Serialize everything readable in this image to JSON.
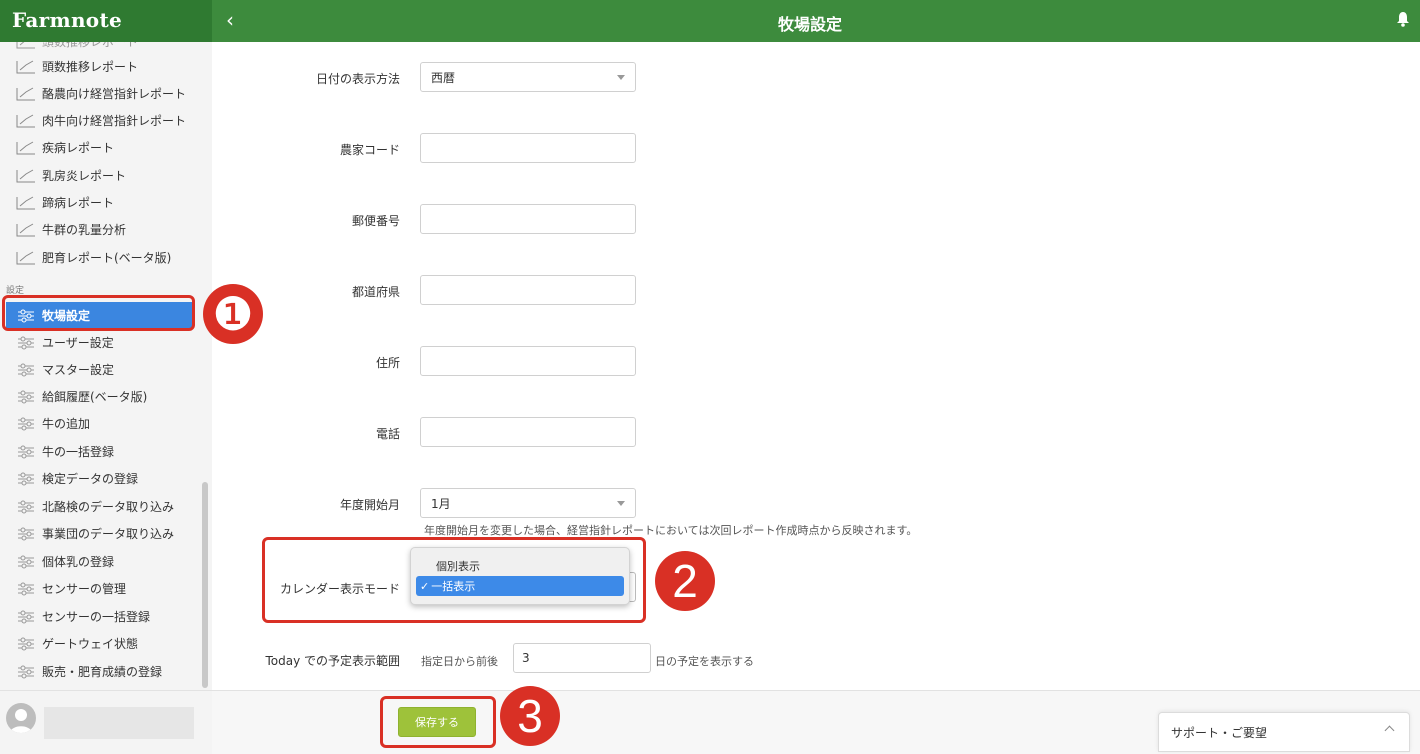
{
  "header": {
    "logo": "Farmnote",
    "back": "‹",
    "title": "牧場設定"
  },
  "sidebar": {
    "partial_top": "頭数推移レポート",
    "reports": [
      "頭数推移レポート",
      "酪農向け経営指針レポート",
      "肉牛向け経営指針レポート",
      "疾病レポート",
      "乳房炎レポート",
      "蹄病レポート",
      "牛群の乳量分析",
      "肥育レポート(ベータ版)"
    ],
    "section_label": "設定",
    "settings": [
      "牧場設定",
      "ユーザー設定",
      "マスター設定",
      "給餌履歴(ベータ版)",
      "牛の追加",
      "牛の一括登録",
      "検定データの登録",
      "北酪検のデータ取り込み",
      "事業団のデータ取り込み",
      "個体乳の登録",
      "センサーの管理",
      "センサーの一括登録",
      "ゲートウェイ状態",
      "販売・肥育成績の登録"
    ]
  },
  "form": {
    "date_format": {
      "label": "日付の表示方法",
      "value": "西暦"
    },
    "farm_code": {
      "label": "農家コード",
      "value": ""
    },
    "postal_code": {
      "label": "郵便番号",
      "value": ""
    },
    "prefecture": {
      "label": "都道府県",
      "value": ""
    },
    "address": {
      "label": "住所",
      "value": ""
    },
    "phone": {
      "label": "電話",
      "value": ""
    },
    "fiscal_start": {
      "label": "年度開始月",
      "value": "1月",
      "hint": "年度開始月を変更した場合、経営指針レポートにおいては次回レポート作成時点から反映されます。"
    },
    "calendar_mode": {
      "label": "カレンダー表示モード",
      "options": [
        "個別表示",
        "一括表示"
      ],
      "selected": "一括表示",
      "check": "✓"
    },
    "today_range": {
      "label": "Today での予定表示範囲",
      "prefix": "指定日から前後",
      "value": "3",
      "suffix": "日の予定を表示する"
    }
  },
  "footer": {
    "save": "保存する",
    "support": "サポート・ご要望"
  },
  "annotations": [
    "❶",
    "2",
    "3"
  ],
  "colors": {
    "header": "#3d8b3d",
    "active": "#3b86e0",
    "save": "#9ec23a",
    "annotation": "#d93025"
  }
}
